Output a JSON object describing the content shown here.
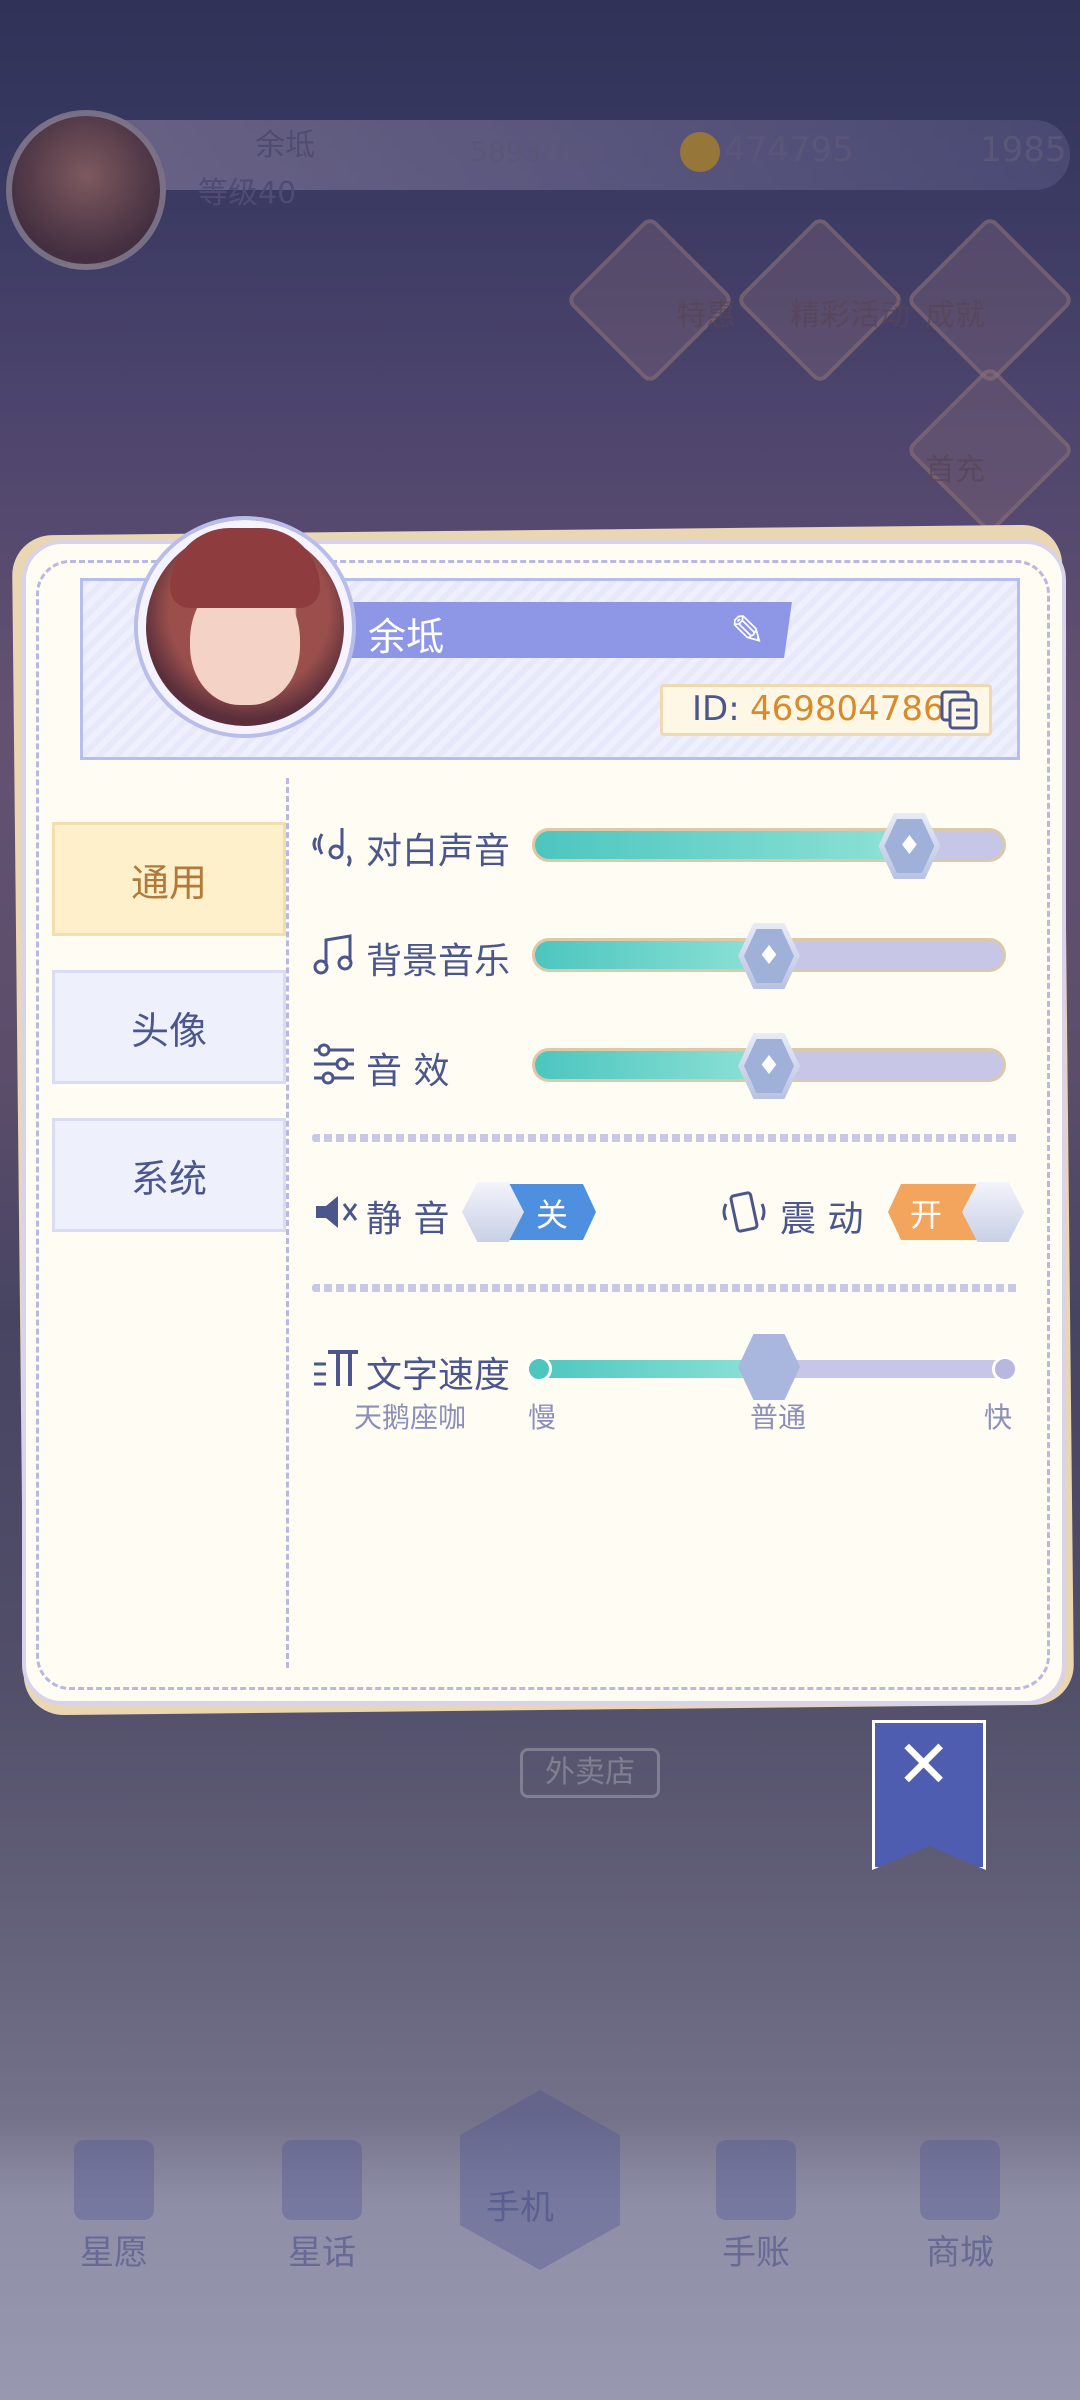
{
  "hud": {
    "player_name": "余坻",
    "level": "等级40",
    "stamina": "5893/120",
    "coins": "474795",
    "gems": "1985"
  },
  "hud_side": [
    "特惠",
    "精彩活动",
    "成就",
    "首充"
  ],
  "profile": {
    "name": "余坻",
    "id_label": "ID:",
    "id_value": "469804786"
  },
  "tabs": {
    "general": "通用",
    "avatar": "头像",
    "system": "系统"
  },
  "settings": {
    "dialogue_voice": {
      "label": "对白声音",
      "level": 0.8
    },
    "bgm": {
      "label": "背景音乐",
      "level": 0.5
    },
    "sfx": {
      "label": "音 效",
      "level": 0.5
    },
    "mute": {
      "label": "静 音",
      "state": "关"
    },
    "vibrate": {
      "label": "震 动",
      "state": "开"
    },
    "text_speed": {
      "label": "文字速度",
      "preview": "天鹅座咖",
      "slow": "慢",
      "normal": "普通",
      "fast": "快",
      "level": 0.5
    }
  },
  "background": {
    "shop_sign": "外卖店"
  },
  "nav": {
    "wish": "星愿",
    "words": "星话",
    "phone": "手机",
    "journal": "手账",
    "mall": "商城"
  },
  "colors": {
    "accent": "#8e97e6",
    "slider_fill": "#4cc6bf",
    "toggle_off": "#4f8fe0",
    "toggle_on": "#f3a55d",
    "id_value": "#d98b2a"
  }
}
